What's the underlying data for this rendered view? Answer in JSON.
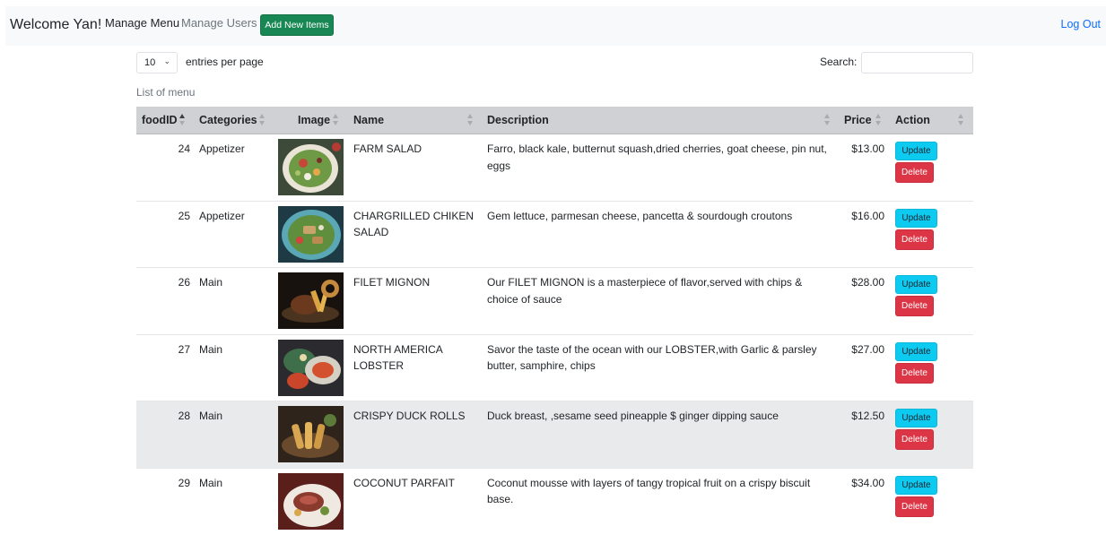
{
  "navbar": {
    "brand": "Welcome Yan!",
    "manage_menu": "Manage Menu",
    "manage_users": "Manage Users",
    "add_new_items": "Add New Items",
    "log_out": "Log Out"
  },
  "controls": {
    "page_length_value": "10",
    "entries_label": "entries per page",
    "search_label": "Search:",
    "search_value": ""
  },
  "table": {
    "caption": "List of menu",
    "headers": {
      "food_id": "foodID",
      "categories": "Categories",
      "image": "Image",
      "name": "Name",
      "description": "Description",
      "price": "Price",
      "action": "Action"
    },
    "sort": {
      "column": "foodID",
      "direction": "ascending"
    },
    "update_label": "Update",
    "delete_label": "Delete",
    "rows": [
      {
        "id": "24",
        "category": "Appetizer",
        "name": "FARM SALAD",
        "description": "Farro, black kale, butternut squash,dried cherries, goat cheese, pin nut, eggs",
        "price": "$13.00",
        "image_icon": "salad-photo-icon"
      },
      {
        "id": "25",
        "category": "Appetizer",
        "name": "CHARGRILLED CHIKEN SALAD",
        "description": "Gem lettuce, parmesan cheese, pancetta & sourdough croutons",
        "price": "$16.00",
        "image_icon": "chicken-salad-photo-icon"
      },
      {
        "id": "26",
        "category": "Main",
        "name": "FILET MIGNON",
        "description": "Our FILET MIGNON is a masterpiece of flavor,served with chips & choice of sauce",
        "price": "$28.00",
        "image_icon": "steak-photo-icon"
      },
      {
        "id": "27",
        "category": "Main",
        "name": "NORTH AMERICA LOBSTER",
        "description": "Savor the taste of the ocean with our LOBSTER,with Garlic & parsley butter, samphire, chips",
        "price": "$27.00",
        "image_icon": "lobster-photo-icon"
      },
      {
        "id": "28",
        "category": "Main",
        "name": "CRISPY DUCK ROLLS",
        "description": "Duck breast, ,sesame seed pineapple $ ginger dipping sauce",
        "price": "$12.50",
        "image_icon": "duck-rolls-photo-icon"
      },
      {
        "id": "29",
        "category": "Main",
        "name": "COCONUT PARFAIT",
        "description": "Coconut mousse with layers of tangy tropical fruit on a crispy biscuit base.",
        "price": "$34.00",
        "image_icon": "plated-dish-photo-icon"
      }
    ]
  },
  "colors": {
    "navbar_bg": "#f8f9fa",
    "add_button": "#198754",
    "link": "#0d6efd",
    "update_button": "#0dcaf0",
    "delete_button": "#dc3545",
    "header_bg": "#cfd1d4",
    "hover_row_bg": "#e9eaeb"
  }
}
